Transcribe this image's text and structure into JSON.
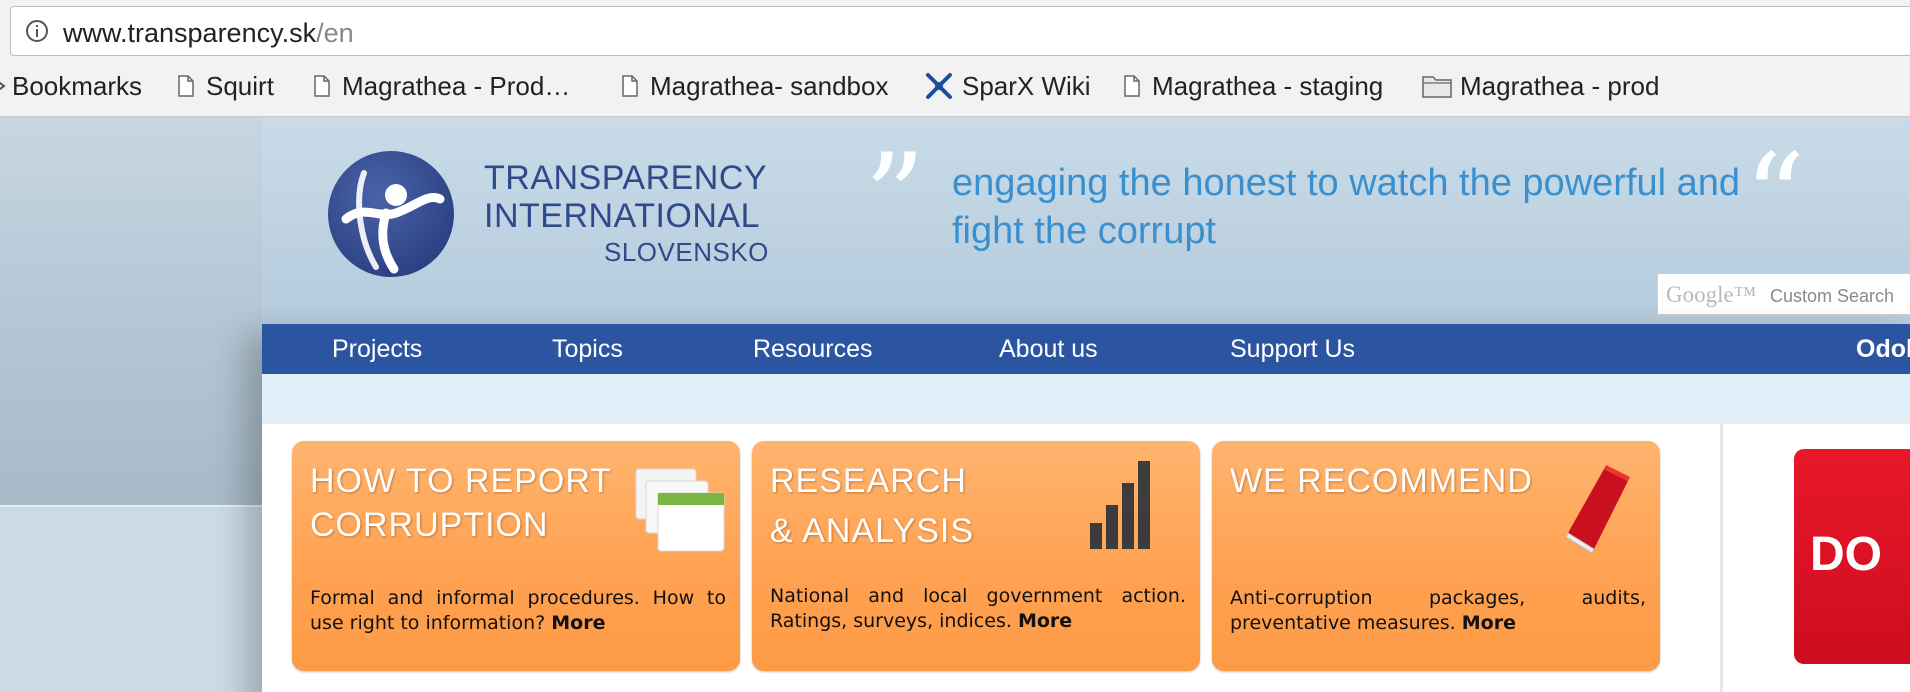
{
  "browser": {
    "url_host": "www.transparency.sk",
    "url_path": "/en",
    "bookmarks": [
      {
        "label": "Bookmarks",
        "icon": "chevron-icon"
      },
      {
        "label": "Squirt",
        "icon": "page-icon"
      },
      {
        "label": "Magrathea - Prod…",
        "icon": "page-icon"
      },
      {
        "label": "Magrathea- sandbox",
        "icon": "page-icon"
      },
      {
        "label": "SparX Wiki",
        "icon": "sparx-logo-icon"
      },
      {
        "label": "Magrathea - staging",
        "icon": "page-icon"
      },
      {
        "label": "Magrathea - prod",
        "icon": "folder-icon"
      }
    ]
  },
  "header": {
    "logo_line1": "TRANSPARENCY",
    "logo_line2": "INTERNATIONAL",
    "logo_line3": "SLOVENSKO",
    "tagline": "engaging the honest to watch the powerful and fight the corrupt",
    "search_brand": "Google™",
    "search_placeholder": "Custom Search"
  },
  "nav": {
    "items": [
      "Projects",
      "Topics",
      "Resources",
      "About us",
      "Support Us"
    ],
    "right_item": "Odob"
  },
  "cards": [
    {
      "title_l1": "HOW TO REPORT",
      "title_l2": "CORRUPTION",
      "desc": "Formal and informal procedures. How to use right to information?",
      "more": "More"
    },
    {
      "title_l1": "RESEARCH",
      "title_l2": "& ANALYSIS",
      "desc": "National and local government action. Ratings, surveys, indices.",
      "more": "More"
    },
    {
      "title_l1": "WE RECOMMEND",
      "title_l2": "",
      "desc": "Anti-corruption packages, audits, preventative measures.",
      "more": "More"
    }
  ],
  "banner": {
    "text": "DO"
  },
  "colors": {
    "nav": "#2c55a1",
    "card": "#ffa252",
    "tagline": "#3a90cf",
    "banner": "#e9172a"
  }
}
